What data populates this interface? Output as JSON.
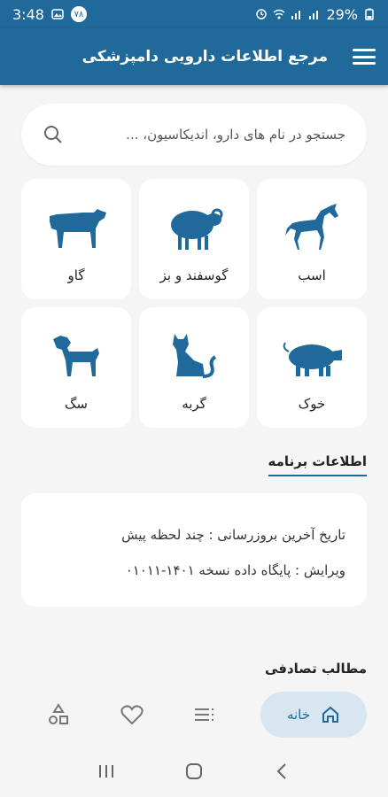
{
  "status_bar": {
    "time": "3:48",
    "notification_badge": "۷۸",
    "battery": "29%"
  },
  "app_bar": {
    "title": "مرجع اطلاعات دارویی دامپزشکی",
    "menu_icon": "hamburger-icon"
  },
  "search": {
    "placeholder": "جستجو در نام های دارو، اندیکاسیون، ..."
  },
  "animals": [
    {
      "label": "اسب",
      "icon": "horse-icon"
    },
    {
      "label": "گوسفند و بز",
      "icon": "sheep-icon"
    },
    {
      "label": "گاو",
      "icon": "cow-icon"
    },
    {
      "label": "خوک",
      "icon": "pig-icon"
    },
    {
      "label": "گربه",
      "icon": "cat-icon"
    },
    {
      "label": "سگ",
      "icon": "dog-icon"
    }
  ],
  "app_info": {
    "title": "اطلاعات برنامه",
    "last_update": "تاریخ آخرین بروزرسانی : چند لحظه پیش",
    "version": "ویرایش : پایگاه داده نسخه ۱۴۰۱-۰۱۰۱۱"
  },
  "random_articles": {
    "title": "مطالب تصادفی"
  },
  "bottom_nav": {
    "home_label": "خانه",
    "items": [
      "home-icon",
      "list-icon",
      "heart-icon",
      "shapes-icon"
    ]
  },
  "colors": {
    "primary": "#1f6a9b",
    "background": "#f5f5f5",
    "card": "#ffffff",
    "nav_active": "#d7e6f0"
  }
}
